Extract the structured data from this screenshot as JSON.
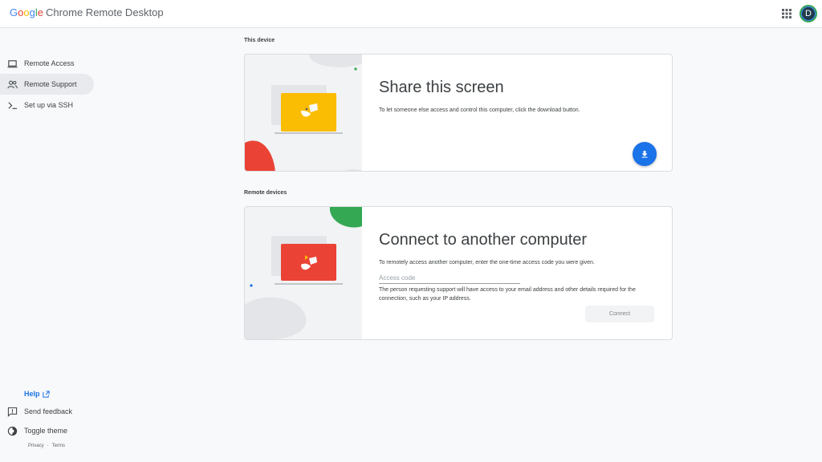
{
  "header": {
    "logo_letters": [
      {
        "ch": "G",
        "color": "#4285f4"
      },
      {
        "ch": "o",
        "color": "#ea4335"
      },
      {
        "ch": "o",
        "color": "#fbbc04"
      },
      {
        "ch": "g",
        "color": "#4285f4"
      },
      {
        "ch": "l",
        "color": "#34a853"
      },
      {
        "ch": "e",
        "color": "#ea4335"
      }
    ],
    "product_name": "Chrome Remote Desktop",
    "apps_icon": "apps-grid-icon",
    "avatar_initial": "D"
  },
  "sidebar": {
    "items": [
      {
        "label": "Remote Access",
        "icon": "laptop-icon",
        "active": false
      },
      {
        "label": "Remote Support",
        "icon": "people-icon",
        "active": true
      },
      {
        "label": "Set up via SSH",
        "icon": "terminal-icon",
        "active": false
      }
    ],
    "help_label": "Help",
    "feedback_label": "Send feedback",
    "theme_label": "Toggle theme",
    "privacy_label": "Privacy",
    "separator": "·",
    "terms_label": "Terms"
  },
  "this_device": {
    "section_label": "This device",
    "title": "Share this screen",
    "description": "To let someone else access and control this computer, click the download button.",
    "download_icon": "download-icon"
  },
  "remote_devices": {
    "section_label": "Remote devices",
    "title": "Connect to another computer",
    "description": "To remotely access another computer, enter the one-time access code you were given.",
    "access_code_placeholder": "Access code",
    "access_code_value": "",
    "consent_text": "The person requesting support will have access to your email address and other details required for the connection, such as your IP address.",
    "connect_label": "Connect"
  },
  "colors": {
    "accent": "#1a73e8",
    "yellow": "#fbbc04",
    "red": "#ea4335",
    "green": "#34a853"
  }
}
